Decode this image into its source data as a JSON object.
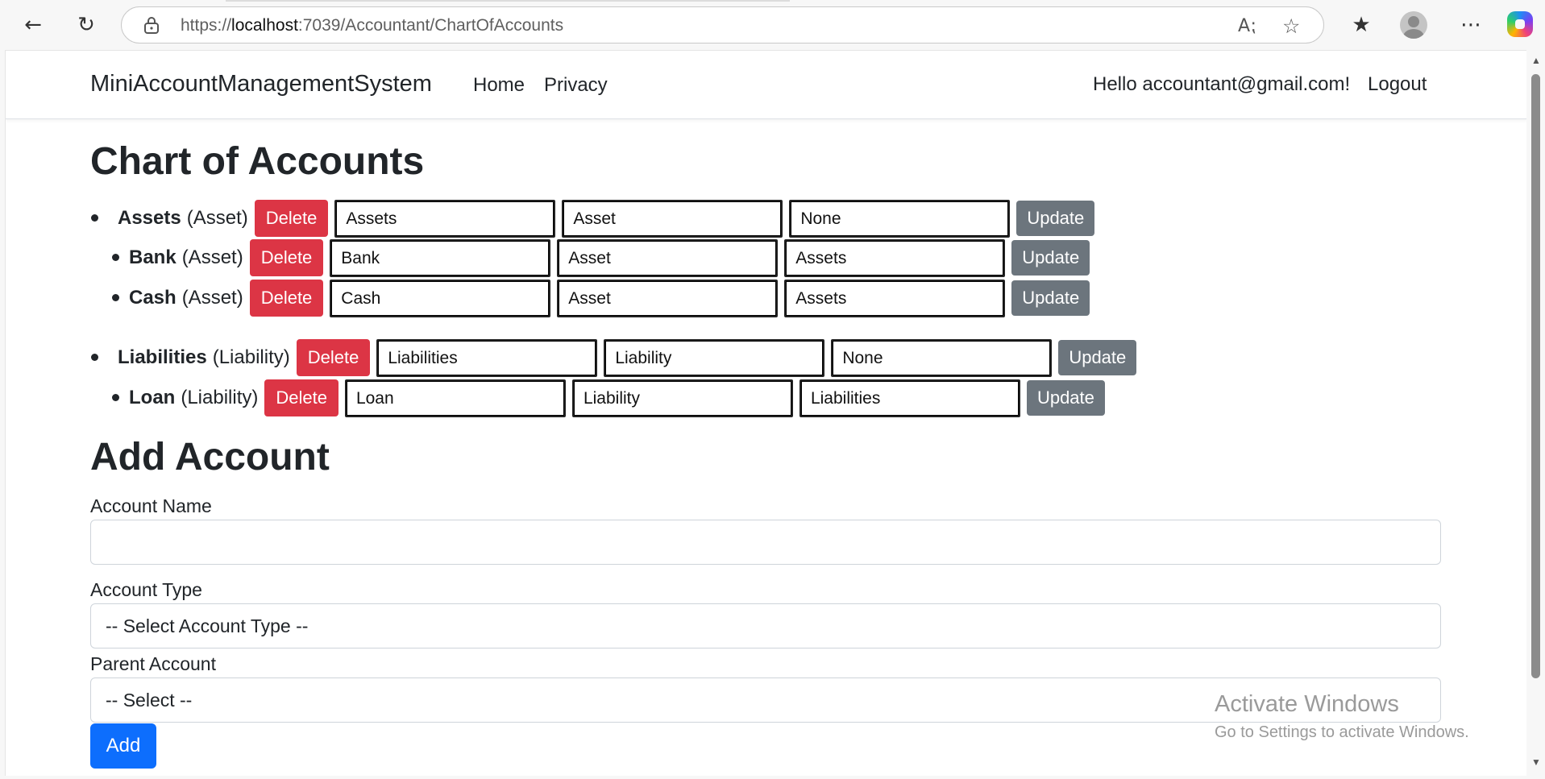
{
  "browser": {
    "url_prefix": "https://",
    "url_host": "localhost",
    "url_rest": ":7039/Accountant/ChartOfAccounts"
  },
  "navbar": {
    "brand": "MiniAccountManagementSystem",
    "links": [
      "Home",
      "Privacy"
    ],
    "greeting": "Hello accountant@gmail.com!",
    "logout": "Logout"
  },
  "chart": {
    "title": "Chart of Accounts",
    "delete_label": "Delete",
    "update_label": "Update",
    "accounts": [
      {
        "name": "Assets",
        "type_display": "(Asset)",
        "name_field": "Assets",
        "type_field": "Asset",
        "parent_field": "None"
      },
      {
        "name": "Bank",
        "type_display": "(Asset)",
        "name_field": "Bank",
        "type_field": "Asset",
        "parent_field": "Assets"
      },
      {
        "name": "Cash",
        "type_display": "(Asset)",
        "name_field": "Cash",
        "type_field": "Asset",
        "parent_field": "Assets"
      },
      {
        "name": "Liabilities",
        "type_display": "(Liability)",
        "name_field": "Liabilities",
        "type_field": "Liability",
        "parent_field": "None"
      },
      {
        "name": "Loan",
        "type_display": "(Liability)",
        "name_field": "Loan",
        "type_field": "Liability",
        "parent_field": "Liabilities"
      }
    ]
  },
  "add_form": {
    "title": "Add Account",
    "account_name_label": "Account Name",
    "account_name_value": "",
    "account_type_label": "Account Type",
    "account_type_selected": "-- Select Account Type --",
    "parent_account_label": "Parent Account",
    "parent_account_selected": "-- Select --",
    "add_button": "Add"
  },
  "watermark": {
    "title": "Activate Windows",
    "subtitle": "Go to Settings to activate Windows."
  },
  "colors": {
    "delete": "#dc3545",
    "update": "#6c757d",
    "primary": "#0d6efd"
  }
}
